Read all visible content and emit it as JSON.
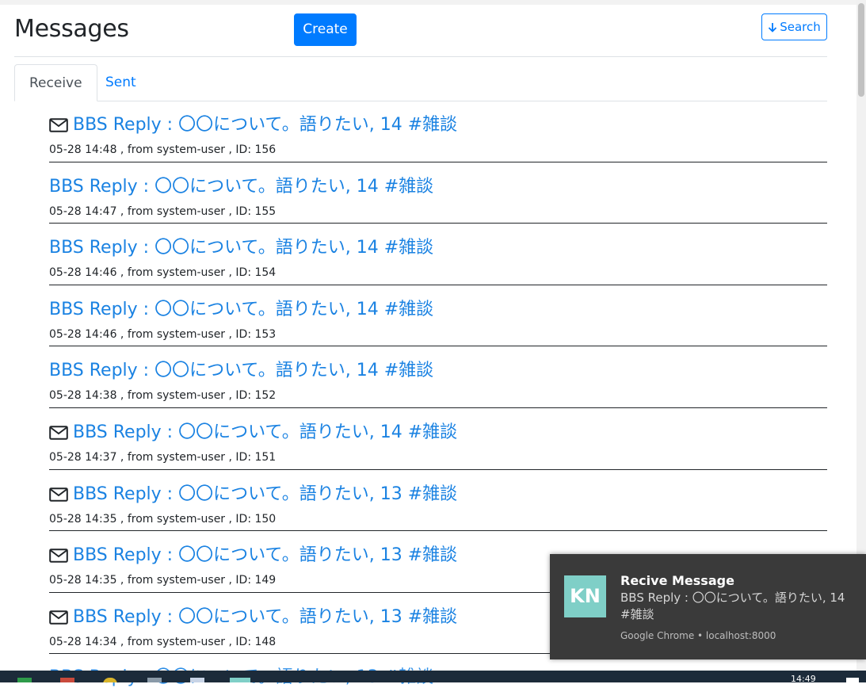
{
  "header": {
    "title": "Messages",
    "create_label": "Create",
    "search_label": "Search"
  },
  "tabs": [
    {
      "label": "Receive",
      "active": true
    },
    {
      "label": "Sent",
      "active": false
    }
  ],
  "messages": [
    {
      "title": "BBS Reply : 〇〇について。語りたい, 14 #雑談",
      "meta": "05-28 14:48 , from system-user , ID: 156",
      "unread": true
    },
    {
      "title": "BBS Reply : 〇〇について。語りたい, 14 #雑談",
      "meta": "05-28 14:47 , from system-user , ID: 155",
      "unread": false
    },
    {
      "title": "BBS Reply : 〇〇について。語りたい, 14 #雑談",
      "meta": "05-28 14:46 , from system-user , ID: 154",
      "unread": false
    },
    {
      "title": "BBS Reply : 〇〇について。語りたい, 14 #雑談",
      "meta": "05-28 14:46 , from system-user , ID: 153",
      "unread": false
    },
    {
      "title": "BBS Reply : 〇〇について。語りたい, 14 #雑談",
      "meta": "05-28 14:38 , from system-user , ID: 152",
      "unread": false
    },
    {
      "title": "BBS Reply : 〇〇について。語りたい, 14 #雑談",
      "meta": "05-28 14:37 , from system-user , ID: 151",
      "unread": true
    },
    {
      "title": "BBS Reply : 〇〇について。語りたい, 13 #雑談",
      "meta": "05-28 14:35 , from system-user , ID: 150",
      "unread": true
    },
    {
      "title": "BBS Reply : 〇〇について。語りたい, 13 #雑談",
      "meta": "05-28 14:35 , from system-user , ID: 149",
      "unread": true
    },
    {
      "title": "BBS Reply : 〇〇について。語りたい, 13 #雑談",
      "meta": "05-28 14:34 , from system-user , ID: 148",
      "unread": true
    }
  ],
  "notification": {
    "avatar": "KN",
    "title": "Recive Message",
    "body": "BBS Reply : 〇〇について。語りたい, 14 #雑談",
    "source": "Google Chrome • localhost:8000"
  },
  "taskbar": {
    "time": "14:49"
  },
  "colors": {
    "primary": "#007bff",
    "link": "#1a82e2",
    "toast_bg": "#3a3a3a",
    "avatar_bg": "#7fcfc7"
  }
}
